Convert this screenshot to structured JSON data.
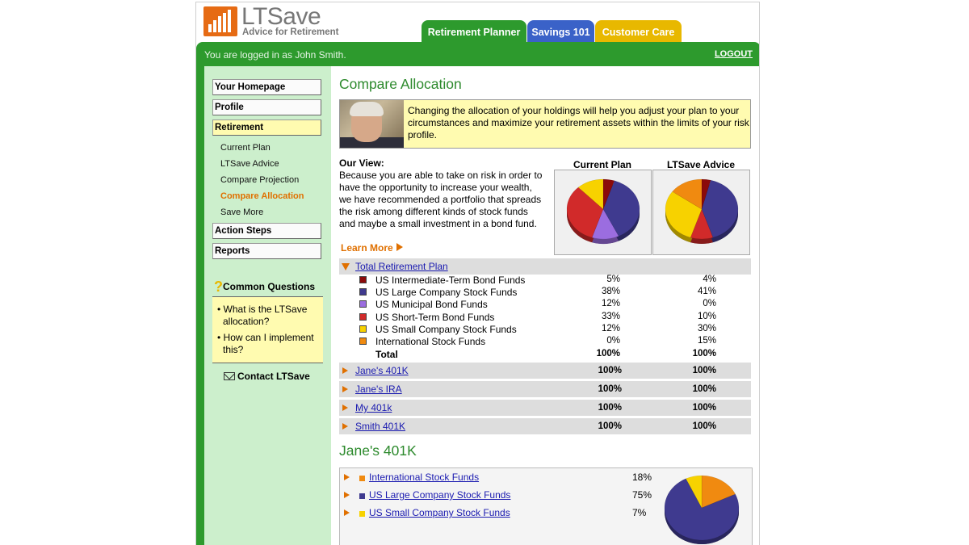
{
  "brand": {
    "name": "LTSave",
    "tagline": "Advice for Retirement"
  },
  "tabs": [
    "Retirement Planner",
    "Savings 101",
    "Customer Care"
  ],
  "header": {
    "login_text": "You are logged in as John Smith.",
    "logout_label": "LOGOUT"
  },
  "sidebar": {
    "nav": [
      "Your Homepage",
      "Profile",
      "Retirement",
      "Action Steps",
      "Reports"
    ],
    "subnav": [
      "Current Plan",
      "LTSave Advice",
      "Compare Projection",
      "Compare Allocation",
      "Save More"
    ],
    "common_questions": {
      "title": "Common Questions",
      "items": [
        "What is the LTSave allocation?",
        "How can I implement this?"
      ]
    },
    "contact_label": "Contact LTSave"
  },
  "main": {
    "title": "Compare Allocation",
    "intro": "Changing the allocation of your holdings will help you adjust your plan to your circumstances and maximize your retirement assets within the limits of your risk profile.",
    "our_view_title": "Our View:",
    "our_view_text": "Because you are able to take on risk in order to have the opportunity to increase your wealth, we have recommended a portfolio that spreads the risk among different kinds of stock funds and maybe a small investment in a bond fund.",
    "learn_more": "Learn More",
    "pie_heads": [
      "Current Plan",
      "LTSave Advice"
    ],
    "total_plan_label": "Total Retirement Plan",
    "funds": [
      {
        "name": "US Intermediate-Term Bond Funds",
        "current": "5%",
        "advice": "4%",
        "color": "#8b0a0a"
      },
      {
        "name": "US Large Company Stock Funds",
        "current": "38%",
        "advice": "41%",
        "color": "#3f3a8f"
      },
      {
        "name": "US Municipal Bond Funds",
        "current": "12%",
        "advice": "0%",
        "color": "#9b6de0"
      },
      {
        "name": "US Short-Term Bond Funds",
        "current": "33%",
        "advice": "10%",
        "color": "#d12a2a"
      },
      {
        "name": "US Small Company Stock Funds",
        "current": "12%",
        "advice": "30%",
        "color": "#f7d200"
      },
      {
        "name": "International Stock Funds",
        "current": "0%",
        "advice": "15%",
        "color": "#f08a10"
      }
    ],
    "total_row": {
      "label": "Total",
      "current": "100%",
      "advice": "100%"
    },
    "accounts": [
      {
        "name": "Jane's 401K",
        "current": "100%",
        "advice": "100%"
      },
      {
        "name": "Jane's IRA",
        "current": "100%",
        "advice": "100%"
      },
      {
        "name": "My 401k",
        "current": "100%",
        "advice": "100%"
      },
      {
        "name": "Smith 401K",
        "current": "100%",
        "advice": "100%"
      }
    ],
    "jane_title": "Jane's 401K",
    "jane_funds": [
      {
        "name": "International Stock Funds",
        "pct": "18%",
        "color": "#f08a10"
      },
      {
        "name": "US Large Company Stock Funds",
        "pct": "75%",
        "color": "#3f3a8f"
      },
      {
        "name": "US Small Company Stock Funds",
        "pct": "7%",
        "color": "#f7d200"
      }
    ]
  },
  "chart_data": [
    {
      "type": "pie",
      "title": "Current Plan",
      "labels": [
        "US Intermediate-Term Bond Funds",
        "US Large Company Stock Funds",
        "US Municipal Bond Funds",
        "US Short-Term Bond Funds",
        "US Small Company Stock Funds",
        "International Stock Funds"
      ],
      "values": [
        5,
        38,
        12,
        33,
        12,
        0
      ]
    },
    {
      "type": "pie",
      "title": "LTSave Advice",
      "labels": [
        "US Intermediate-Term Bond Funds",
        "US Large Company Stock Funds",
        "US Municipal Bond Funds",
        "US Short-Term Bond Funds",
        "US Small Company Stock Funds",
        "International Stock Funds"
      ],
      "values": [
        4,
        41,
        0,
        10,
        30,
        15
      ]
    },
    {
      "type": "pie",
      "title": "Jane's 401K",
      "labels": [
        "International Stock Funds",
        "US Large Company Stock Funds",
        "US Small Company Stock Funds"
      ],
      "values": [
        18,
        75,
        7
      ]
    }
  ]
}
